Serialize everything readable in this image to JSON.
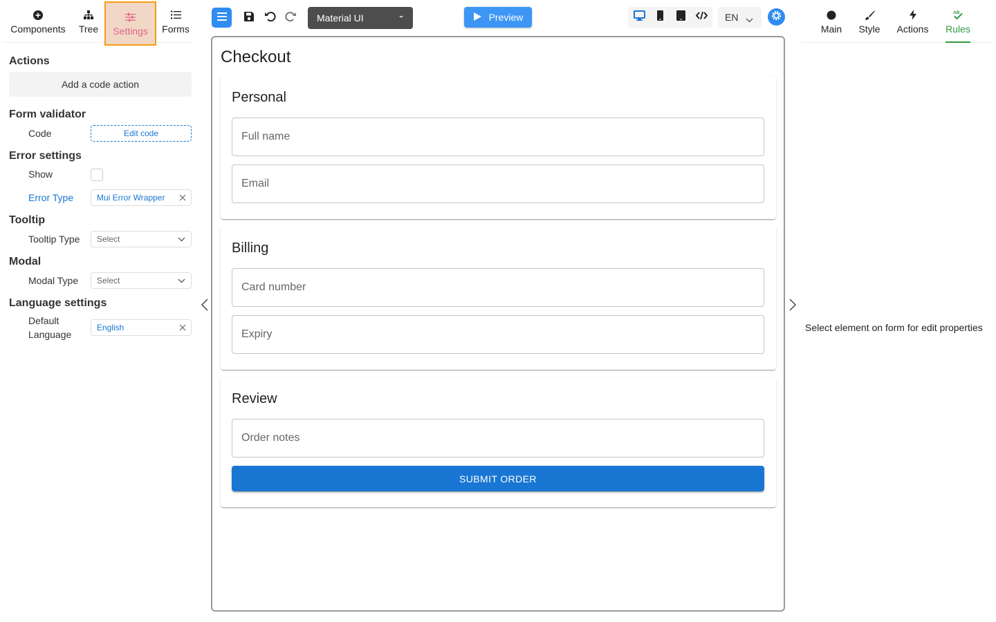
{
  "left_tabs": [
    {
      "label": "Components",
      "icon": "plus-circle-icon"
    },
    {
      "label": "Tree",
      "icon": "tree-icon"
    },
    {
      "label": "Settings",
      "icon": "sliders-icon",
      "active": true
    },
    {
      "label": "Forms",
      "icon": "list-icon"
    }
  ],
  "settings": {
    "actions": {
      "title": "Actions",
      "add_button": "Add a code action"
    },
    "form_validator": {
      "title": "Form validator",
      "code_label": "Code",
      "edit_button": "Edit code"
    },
    "error_settings": {
      "title": "Error settings",
      "show_label": "Show",
      "show_checked": false,
      "error_type_label": "Error Type",
      "error_type_value": "Mui Error Wrapper"
    },
    "tooltip": {
      "title": "Tooltip",
      "type_label": "Tooltip Type",
      "type_placeholder": "Select"
    },
    "modal": {
      "title": "Modal",
      "type_label": "Modal Type",
      "type_placeholder": "Select"
    },
    "language": {
      "title": "Language settings",
      "default_label_1": "Default",
      "default_label_2": "Language",
      "default_value": "English"
    }
  },
  "toolbar": {
    "theme": "Material UI",
    "preview": "Preview",
    "language": "EN"
  },
  "form": {
    "title": "Checkout",
    "sections": [
      {
        "title": "Personal",
        "fields": [
          "Full name",
          "Email"
        ]
      },
      {
        "title": "Billing",
        "fields": [
          "Card number",
          "Expiry"
        ]
      },
      {
        "title": "Review",
        "fields": [
          "Order notes"
        ],
        "submit": "SUBMIT ORDER"
      }
    ]
  },
  "right_tabs": [
    {
      "label": "Main",
      "icon": "circle-icon"
    },
    {
      "label": "Style",
      "icon": "brush-icon"
    },
    {
      "label": "Actions",
      "icon": "lightning-icon"
    },
    {
      "label": "Rules",
      "icon": "rules-icon",
      "active": true
    }
  ],
  "right_panel": {
    "hint": "Select element on form for edit properties"
  },
  "colors": {
    "accent_blue": "#1976d2",
    "settings_pink": "#e0648b",
    "highlight_orange": "#f39c12",
    "rules_green": "#2e9a3e"
  }
}
